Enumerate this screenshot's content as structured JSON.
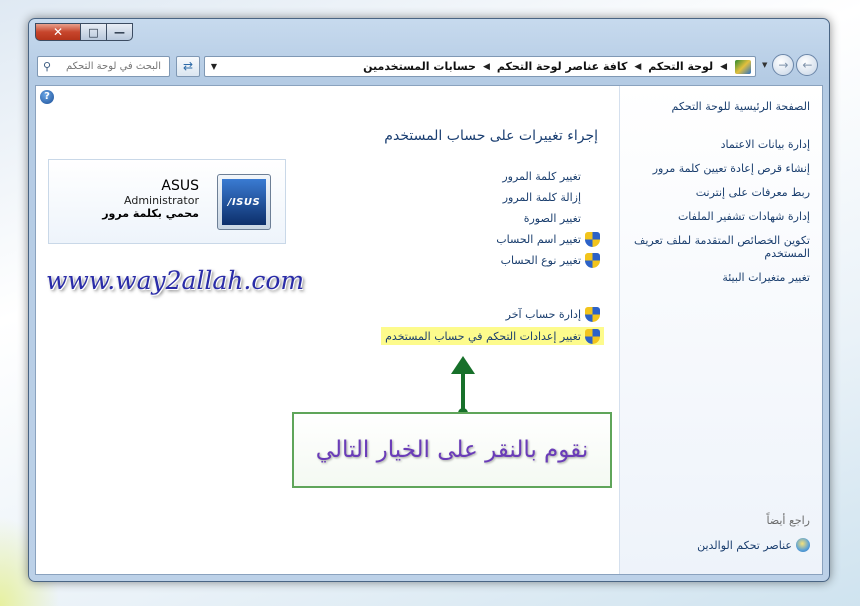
{
  "window": {
    "close_label": "✕",
    "maximize_label": "□",
    "minimize_label": "—"
  },
  "toolbar": {
    "search_placeholder": "البحث في لوحة التحكم",
    "search_icon": "search-icon",
    "refresh_icon": "refresh-icon",
    "breadcrumb": [
      "لوحة التحكم",
      "كافة عناصر لوحة التحكم",
      "حسابات المستخدمين"
    ],
    "separator": "◀",
    "dropdown": "▼"
  },
  "sidebar": {
    "home": "الصفحة الرئيسية للوحة التحكم",
    "items": [
      "إدارة بيانات الاعتماد",
      "إنشاء قرص إعادة تعيين كلمة مرور",
      "ربط معرفات على إنترنت",
      "إدارة شهادات تشفير الملفات",
      "تكوين الخصائص المتقدمة لملف تعريف المستخدم",
      "تغيير متغيرات البيئة"
    ],
    "see_also": "راجع أيضاً",
    "parental_controls": "عناصر تحكم الوالدين"
  },
  "main": {
    "help_label": "?",
    "heading": "إجراء تغييرات على حساب المستخدم",
    "account": {
      "picture_text": "/ISUS",
      "name": "ASUS",
      "role": "Administrator",
      "password_status": "محمي بكلمة مرور"
    },
    "tasks": [
      {
        "label": "تغيير كلمة المرور",
        "shield": false
      },
      {
        "label": "إزالة كلمة المرور",
        "shield": false
      },
      {
        "label": "تغيير الصورة",
        "shield": false
      },
      {
        "label": "تغيير اسم الحساب",
        "shield": true
      },
      {
        "label": "تغيير نوع الحساب",
        "shield": true
      }
    ],
    "tasks2": [
      {
        "label": "إدارة حساب آخر",
        "shield": true
      },
      {
        "label": "تغيير إعدادات التحكم في حساب المستخدم",
        "shield": true,
        "highlighted": true
      }
    ]
  },
  "overlay": {
    "watermark": "www.way2allah.com",
    "callout_text": "نقوم بالنقر على الخيار التالي",
    "arrow_color": "#17702a",
    "highlight_color": "#fdfb8c"
  }
}
